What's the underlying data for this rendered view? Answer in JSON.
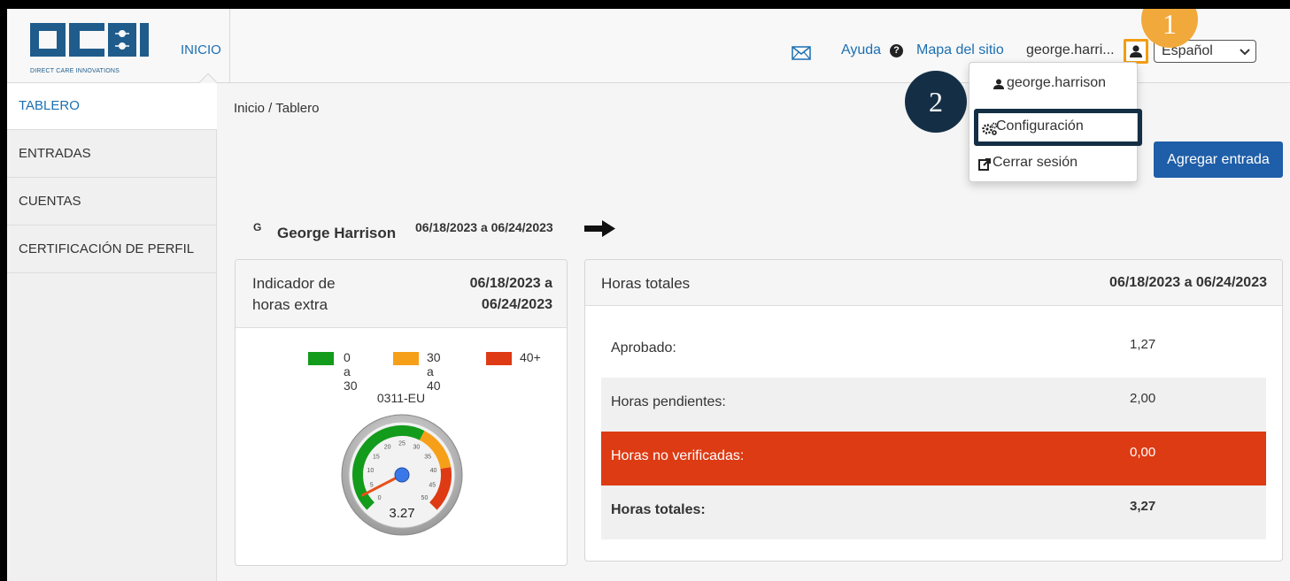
{
  "header": {
    "logo_caption": "DIRECT CARE INNOVATIONS",
    "nav_home": "INICIO",
    "help_label": "Ayuda",
    "sitemap_label": "Mapa del sitio",
    "username_truncated": "george.harri...",
    "language_selected": "Español"
  },
  "callouts": {
    "first": "1",
    "second": "2"
  },
  "user_menu": {
    "username": "george.harrison",
    "settings_label": "Configuración",
    "logout_label": "Cerrar sesión"
  },
  "sidebar": {
    "items": [
      {
        "label": "TABLERO",
        "active": true
      },
      {
        "label": "ENTRADAS",
        "active": false
      },
      {
        "label": "CUENTAS",
        "active": false
      },
      {
        "label": "CERTIFICACIÓN DE PERFIL",
        "active": false
      }
    ]
  },
  "main": {
    "breadcrumb": "Inicio / Tablero",
    "add_entry_label": "Agregar entrada",
    "person_initial": "G",
    "person_name": "George Harrison",
    "period": "06/18/2023 a 06/24/2023"
  },
  "overtime_panel": {
    "title": "Indicador de horas extra",
    "period": "06/18/2023 a 06/24/2023",
    "legend": [
      {
        "label": "0 a 30",
        "color": "#139b1c"
      },
      {
        "label": "30 a 40",
        "color": "#f6a01a"
      },
      {
        "label": "40+",
        "color": "#de3a14"
      }
    ],
    "gauge_label": "0311-EU",
    "gauge_value": "3.27",
    "gauge_ticks": [
      "0",
      "5",
      "10",
      "15",
      "20",
      "25",
      "30",
      "35",
      "40",
      "45",
      "50"
    ]
  },
  "totals_panel": {
    "title": "Horas totales",
    "period": "06/18/2023 a 06/24/2023",
    "rows": [
      {
        "label": "Aprobado:",
        "value": "1,27"
      },
      {
        "label": "Horas pendientes:",
        "value": "2,00"
      },
      {
        "label": "Horas no verificadas:",
        "value": "0,00"
      },
      {
        "label": "Horas totales:",
        "value": "3,27"
      }
    ]
  },
  "colors": {
    "accent": "#1c6fb2",
    "button": "#1f5ea8",
    "highlight_orange": "#f39c12",
    "highlight_navy": "#142f45",
    "alert_red": "#dd3b14"
  }
}
